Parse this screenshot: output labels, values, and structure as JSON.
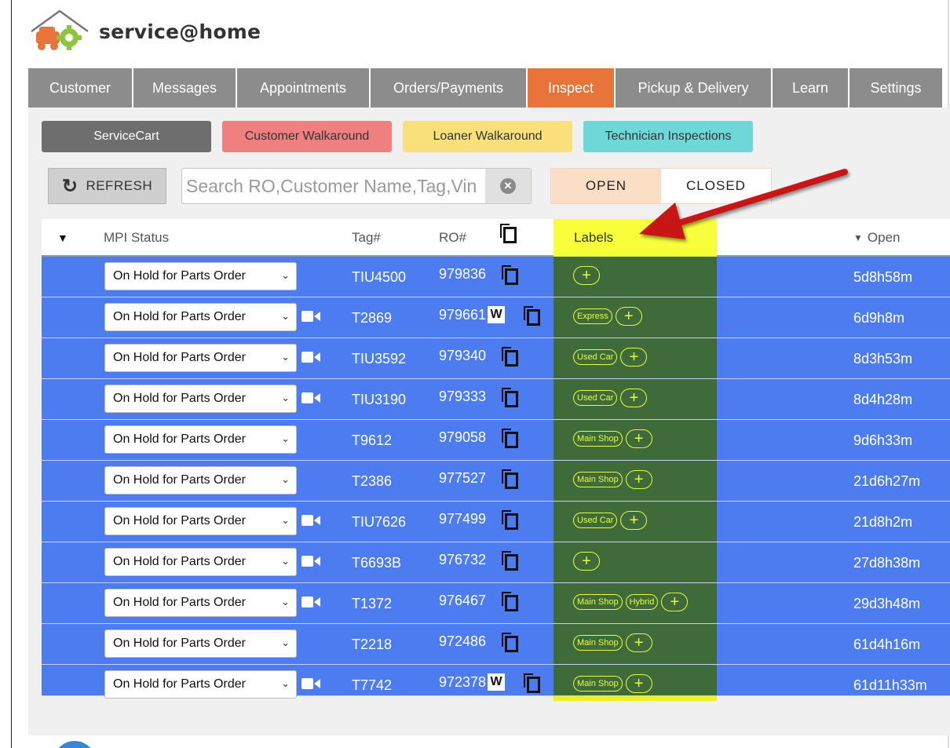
{
  "app": {
    "title": "service@home"
  },
  "nav": [
    {
      "label": "Customer",
      "active": false
    },
    {
      "label": "Messages",
      "active": false
    },
    {
      "label": "Appointments",
      "active": false
    },
    {
      "label": "Orders/Payments",
      "active": false
    },
    {
      "label": "Inspect",
      "active": true
    },
    {
      "label": "Pickup & Delivery",
      "active": false
    },
    {
      "label": "Learn",
      "active": false
    },
    {
      "label": "Settings",
      "active": false
    }
  ],
  "subtabs": [
    {
      "label": "ServiceCart",
      "bg": "#6e6e6e",
      "fg": "#ffffff"
    },
    {
      "label": "Customer Walkaround",
      "bg": "#f08080",
      "fg": "#333333"
    },
    {
      "label": "Loaner Walkaround",
      "bg": "#f9e07a",
      "fg": "#333333"
    },
    {
      "label": "Technician Inspections",
      "bg": "#6ed8d8",
      "fg": "#333333"
    }
  ],
  "toolbar": {
    "refresh_label": "REFRESH",
    "search_placeholder": "Search RO,Customer Name,Tag,Vin",
    "open_label": "OPEN",
    "closed_label": "CLOSED"
  },
  "table": {
    "headers": {
      "mpi_status": "MPI Status",
      "tag": "Tag#",
      "ro": "RO#",
      "labels": "Labels",
      "open": "Open"
    },
    "rows": [
      {
        "status": "On Hold for Parts Order",
        "video": false,
        "tag": "TIU4500",
        "ro": "979836",
        "w": false,
        "labels": [],
        "open": "5d8h58m"
      },
      {
        "status": "On Hold for Parts Order",
        "video": true,
        "tag": "T2869",
        "ro": "979661",
        "w": true,
        "labels": [
          "Express"
        ],
        "open": "6d9h8m"
      },
      {
        "status": "On Hold for Parts Order",
        "video": true,
        "tag": "TIU3592",
        "ro": "979340",
        "w": false,
        "labels": [
          "Used Car"
        ],
        "open": "8d3h53m"
      },
      {
        "status": "On Hold for Parts Order",
        "video": true,
        "tag": "TIU3190",
        "ro": "979333",
        "w": false,
        "labels": [
          "Used Car"
        ],
        "open": "8d4h28m"
      },
      {
        "status": "On Hold for Parts Order",
        "video": false,
        "tag": "T9612",
        "ro": "979058",
        "w": false,
        "labels": [
          "Main Shop"
        ],
        "open": "9d6h33m"
      },
      {
        "status": "On Hold for Parts Order",
        "video": false,
        "tag": "T2386",
        "ro": "977527",
        "w": false,
        "labels": [
          "Main Shop"
        ],
        "open": "21d6h27m"
      },
      {
        "status": "On Hold for Parts Order",
        "video": true,
        "tag": "TIU7626",
        "ro": "977499",
        "w": false,
        "labels": [
          "Used Car"
        ],
        "open": "21d8h2m"
      },
      {
        "status": "On Hold for Parts Order",
        "video": true,
        "tag": "T6693B",
        "ro": "976732",
        "w": false,
        "labels": [],
        "open": "27d8h38m"
      },
      {
        "status": "On Hold for Parts Order",
        "video": true,
        "tag": "T1372",
        "ro": "976467",
        "w": false,
        "labels": [
          "Main Shop",
          "Hybrid"
        ],
        "open": "29d3h48m"
      },
      {
        "status": "On Hold for Parts Order",
        "video": false,
        "tag": "T2218",
        "ro": "972486",
        "w": false,
        "labels": [
          "Main Shop"
        ],
        "open": "61d4h16m"
      },
      {
        "status": "On Hold for Parts Order",
        "video": true,
        "tag": "T7742",
        "ro": "972378",
        "w": true,
        "labels": [
          "Main Shop"
        ],
        "open": "61d11h33m"
      }
    ],
    "w_badge": "W",
    "plus": "+"
  },
  "colors": {
    "row_bg": "#4d7cf0",
    "labels_highlight": "#f8ff3a",
    "labels_column": "#3f6a3a",
    "active_tab": "#e8743a",
    "arrow": "#c81414"
  }
}
